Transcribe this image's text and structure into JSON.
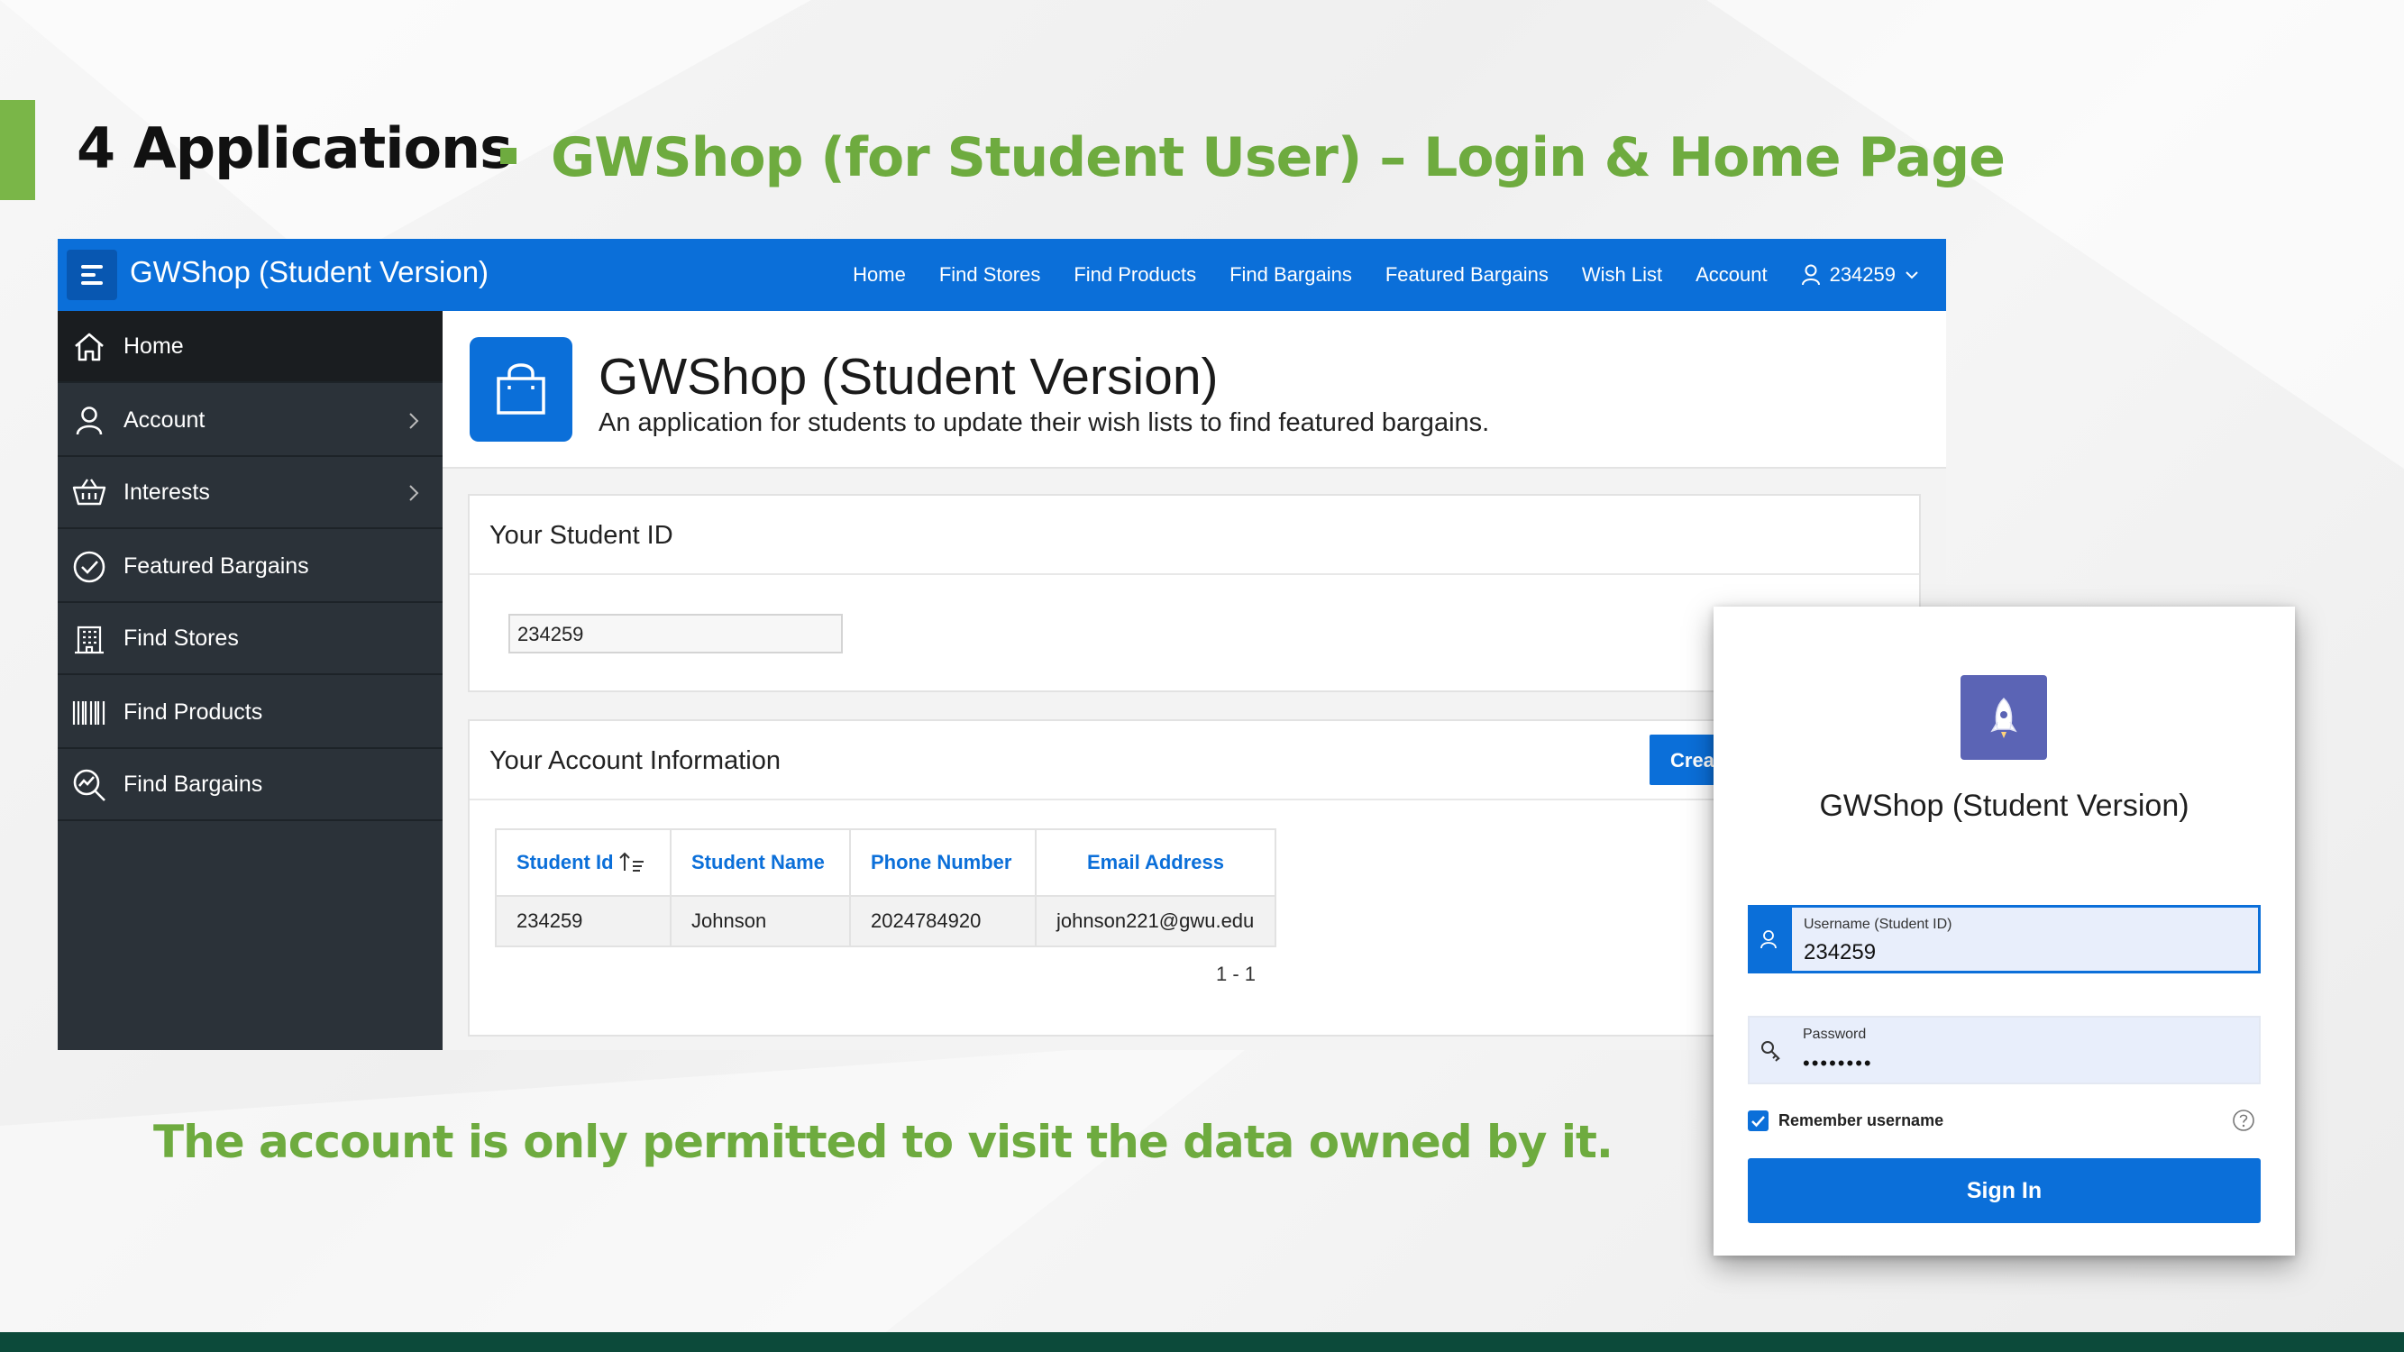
{
  "slide": {
    "section_title": "4 Applications",
    "subtitle": "GWShop (for Student User) – Login & Home Page",
    "note": "The account is only permitted to visit the data owned by it.",
    "accent_color": "#6eab3f"
  },
  "app": {
    "name": "GWShop (Student Version)",
    "brand_color": "#0b6fd9",
    "nav": [
      "Home",
      "Find Stores",
      "Find Products",
      "Find Bargains",
      "Featured Bargains",
      "Wish List",
      "Account"
    ],
    "user": "234259"
  },
  "sidebar": {
    "items": [
      {
        "label": "Home",
        "icon": "home-icon",
        "active": true
      },
      {
        "label": "Account",
        "icon": "user-icon",
        "submenu": true
      },
      {
        "label": "Interests",
        "icon": "basket-icon",
        "submenu": true
      },
      {
        "label": "Featured Bargains",
        "icon": "check-circle-icon"
      },
      {
        "label": "Find Stores",
        "icon": "building-icon"
      },
      {
        "label": "Find Products",
        "icon": "barcode-icon"
      },
      {
        "label": "Find Bargains",
        "icon": "search-chart-icon"
      }
    ]
  },
  "hero": {
    "title": "GWShop (Student Version)",
    "description": "An application for students to update their wish lists to find featured bargains.",
    "icon": "shopping-bag-icon"
  },
  "student_card": {
    "title": "Your Student ID",
    "value": "234259"
  },
  "account_card": {
    "title": "Your Account Information",
    "create_label": "Crea",
    "columns": [
      "Student Id",
      "Student Name",
      "Phone Number",
      "Email Address"
    ],
    "rows": [
      [
        "234259",
        "Johnson",
        "2024784920",
        "johnson221@gwu.edu"
      ]
    ],
    "pagination": "1 - 1"
  },
  "login": {
    "title": "GWShop (Student Version)",
    "logo_icon": "rocket-icon",
    "username_label": "Username (Student ID)",
    "username_value": "234259",
    "password_label": "Password",
    "password_mask": "••••••••",
    "remember_label": "Remember username",
    "remember_checked": true,
    "signin_label": "Sign In"
  }
}
